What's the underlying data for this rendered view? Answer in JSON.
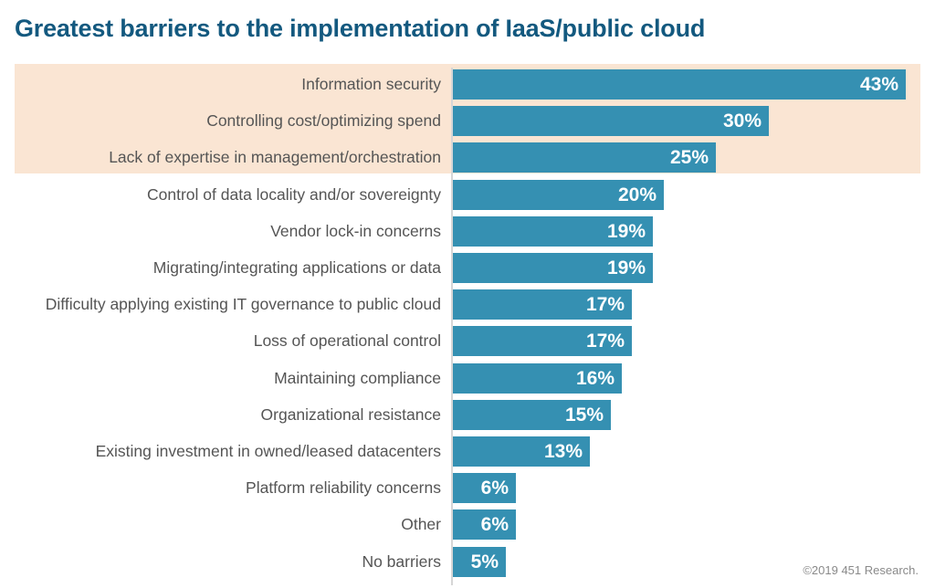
{
  "chart_data": {
    "type": "bar",
    "orientation": "horizontal",
    "title": "Greatest barriers to the implementation of IaaS/public cloud",
    "xlabel": "",
    "ylabel": "",
    "xlim": [
      0,
      43
    ],
    "grid": false,
    "legend": null,
    "value_suffix": "%",
    "categories": [
      "Information security",
      "Controlling cost/optimizing spend",
      "Lack of expertise in management/orchestration",
      "Control of data locality and/or sovereignty",
      "Vendor lock-in concerns",
      "Migrating/integrating applications or data",
      "Difficulty applying existing IT governance to public cloud",
      "Loss of operational control",
      "Maintaining compliance",
      "Organizational resistance",
      "Existing investment in owned/leased datacenters",
      "Platform reliability concerns",
      "Other",
      "No barriers"
    ],
    "values": [
      43,
      30,
      25,
      20,
      19,
      19,
      17,
      17,
      16,
      15,
      13,
      6,
      6,
      5
    ],
    "value_labels": [
      "43%",
      "30%",
      "25%",
      "20%",
      "19%",
      "19%",
      "17%",
      "17%",
      "16%",
      "15%",
      "13%",
      "6%",
      "6%",
      "5%"
    ],
    "highlighted_categories": [
      "Information security",
      "Controlling cost/optimizing spend",
      "Lack of expertise in management/orchestration"
    ],
    "colors": {
      "bar": "#3590b2",
      "highlight_band": "#fae5d3",
      "title": "#13597f",
      "label": "#555555",
      "value_label": "#ffffff",
      "axis_line": "#d6d6d6",
      "background": "#ffffff",
      "credit": "#8a8a8a"
    }
  },
  "footer": {
    "credit": "©2019 451 Research."
  }
}
